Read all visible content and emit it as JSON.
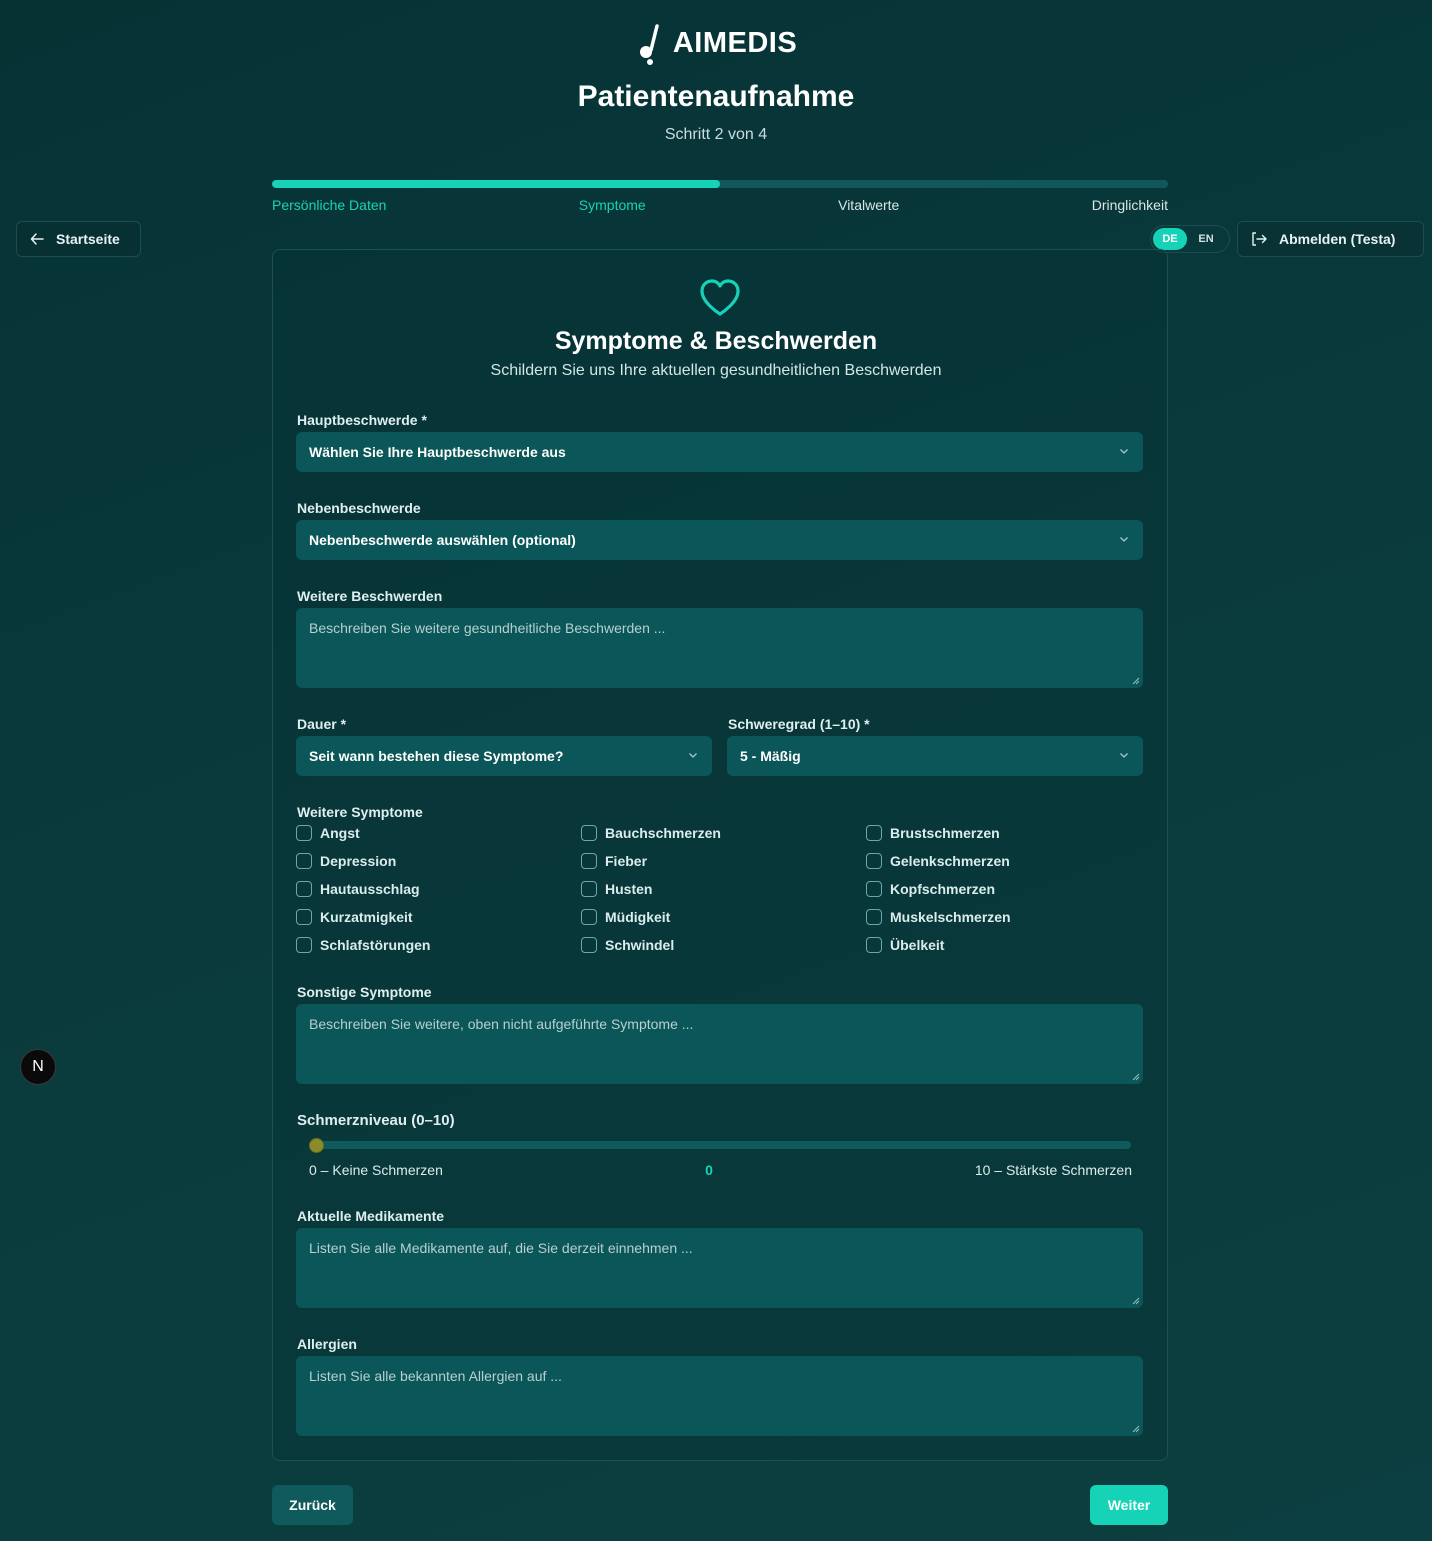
{
  "brand": {
    "name": "AIMEDIS",
    "accent": "#16d3b8"
  },
  "header": {
    "title": "Patientenaufnahme",
    "step": "Schritt 2 von 4"
  },
  "progress": {
    "value": 0.5,
    "steps": [
      {
        "label": "Persönliche Daten",
        "state": "done"
      },
      {
        "label": "Symptome",
        "state": "current"
      },
      {
        "label": "Vitalwerte",
        "state": "todo"
      },
      {
        "label": "Dringlichkeit",
        "state": "todo"
      }
    ]
  },
  "nav": {
    "home": "Startseite",
    "logout": "Abmelden (Testa)"
  },
  "lang": {
    "active": "DE",
    "other": "EN"
  },
  "card": {
    "title": "Symptome & Beschwerden",
    "subtitle": "Schildern Sie uns Ihre aktuellen gesundheitlichen Beschwerden"
  },
  "form": {
    "main": {
      "label": "Hauptbeschwerde *",
      "value": "Wählen Sie Ihre Hauptbeschwerde aus"
    },
    "secondary": {
      "label": "Nebenbeschwerde",
      "value": "Nebenbeschwerde auswählen (optional)"
    },
    "further": {
      "label": "Weitere Beschwerden",
      "placeholder": "Beschreiben Sie weitere gesundheitliche Beschwerden ..."
    },
    "duration": {
      "label": "Dauer *",
      "value": "Seit wann bestehen diese Symptome?"
    },
    "severity": {
      "label": "Schweregrad (1–10) *",
      "value": "5 - Mäßig"
    },
    "symptoms": {
      "label": "Weitere Symptome",
      "items": [
        "Angst",
        "Bauchschmerzen",
        "Brustschmerzen",
        "Depression",
        "Fieber",
        "Gelenkschmerzen",
        "Hautausschlag",
        "Husten",
        "Kopfschmerzen",
        "Kurzatmigkeit",
        "Müdigkeit",
        "Muskelschmerzen",
        "Schlafstörungen",
        "Schwindel",
        "Übelkeit"
      ]
    },
    "other": {
      "label": "Sonstige Symptome",
      "placeholder": "Beschreiben Sie weitere, oben nicht aufgeführte Symptome ..."
    },
    "pain": {
      "label": "Schmerzniveau (0–10)",
      "min_label": "0 – Keine Schmerzen",
      "max_label": "10 – Stärkste Schmerzen",
      "value": "0"
    },
    "meds": {
      "label": "Aktuelle Medikamente",
      "placeholder": "Listen Sie alle Medikamente auf, die Sie derzeit einnehmen ..."
    },
    "allergies": {
      "label": "Allergien",
      "placeholder": "Listen Sie alle bekannten Allergien auf ..."
    }
  },
  "actions": {
    "back": "Zurück",
    "next": "Weiter"
  },
  "dev_badge": "N"
}
